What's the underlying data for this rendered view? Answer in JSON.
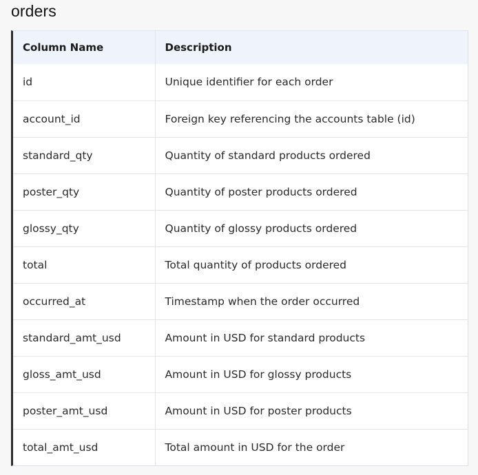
{
  "table_title": "orders",
  "columns": {
    "name": "Column Name",
    "description": "Description"
  },
  "rows": [
    {
      "name": "id",
      "description": "Unique identifier for each order"
    },
    {
      "name": "account_id",
      "description": "Foreign key referencing the accounts table (id)"
    },
    {
      "name": "standard_qty",
      "description": "Quantity of standard products ordered"
    },
    {
      "name": "poster_qty",
      "description": "Quantity of poster products ordered"
    },
    {
      "name": "glossy_qty",
      "description": "Quantity of glossy products ordered"
    },
    {
      "name": "total",
      "description": "Total quantity of products ordered"
    },
    {
      "name": "occurred_at",
      "description": "Timestamp when the order occurred"
    },
    {
      "name": "standard_amt_usd",
      "description": "Amount in USD for standard products"
    },
    {
      "name": "gloss_amt_usd",
      "description": "Amount in USD for glossy products"
    },
    {
      "name": "poster_amt_usd",
      "description": "Amount in USD for poster products"
    },
    {
      "name": "total_amt_usd",
      "description": "Total amount in USD for the order"
    }
  ]
}
